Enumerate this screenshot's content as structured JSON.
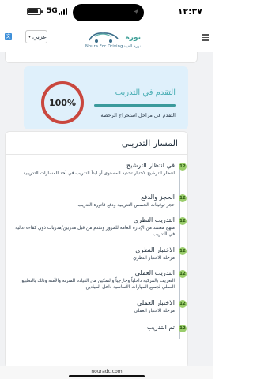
{
  "status_bar": {
    "time": "١٢:٣٧",
    "network": "5G",
    "icons": {
      "location": "location-arrow-icon",
      "signal": "signal-bars-icon",
      "battery": "battery-icon"
    }
  },
  "header": {
    "language": "عربي",
    "logo_ar": "نورة",
    "logo_en": "Noura For Driving",
    "logo_sub_ar": "نورة للقيادة",
    "icons": {
      "translate": "translate-icon",
      "menu": "hamburger-menu-icon"
    }
  },
  "progress": {
    "title": "التقدم في التدريب",
    "percent_label": "100%",
    "percent": 100,
    "description": "التقدم في مراحل استخراج الرخصة",
    "colors": {
      "ring": "#c9473e",
      "accent": "#3a9a9c",
      "card": "#dff0fb"
    }
  },
  "path": {
    "title": "المسار التدريبي",
    "steps": [
      {
        "num": "12",
        "title": "في انتظار الترشيح",
        "desc": "انتظار الترشيح لاختبار تحديد المستوى أو ابدأ التدريب في أحد المسارات التدريبية"
      },
      {
        "num": "12",
        "title": "الحجز والدفع",
        "desc": "حجز توقيتات الحصص التدريبية ودفع فاتورة التدريب."
      },
      {
        "num": "12",
        "title": "التدريب النظري",
        "desc": "منهج معتمد من الإدارة العامة للمرور وتقدم من قبل مدربين/مدربات ذوي كفاءة عالية في التدريب"
      },
      {
        "num": "12",
        "title": "الاختبار النظري",
        "desc": "مرحلة الاختبار النظري"
      },
      {
        "num": "12",
        "title": "التدريب العملي",
        "desc": "التعريف بالمركبة داخلياً وخارجياً والتمكين من القيادة المتزنة والآمنة وذلك بالتطبيق العملي لجميع المهارات الأساسية داخل الميادين"
      },
      {
        "num": "12",
        "title": "الاختبار العملي",
        "desc": "مرحلة الاختبار العملي"
      },
      {
        "num": "12",
        "title": "تم التدريب",
        "desc": ""
      }
    ]
  },
  "footer": {
    "url": "nouradc.com"
  }
}
